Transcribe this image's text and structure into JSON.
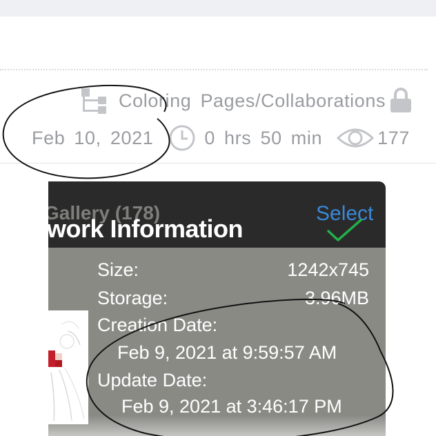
{
  "header": {
    "category": "Coloring Pages/Collaborations",
    "date": "Feb 10, 2021",
    "duration": "0 hrs 50 min",
    "views": "177"
  },
  "dialog": {
    "gallery_title": "Gallery (178)",
    "title": "work Information",
    "select_label": "Select",
    "fields": [
      {
        "label": "Size:",
        "value": "1242x745"
      },
      {
        "label": "Storage:",
        "value": "3.96MB"
      },
      {
        "label": "Creation Date:",
        "value": "Feb 9, 2021 at 9:59:57 AM"
      },
      {
        "label": "Update Date:",
        "value": "Feb 9, 2021 at 3:46:17 PM"
      }
    ]
  },
  "colors": {
    "meta_text": "#9a9ca1",
    "panel_bg": "#8a8a85",
    "header_bg": "#2a2a2a",
    "select_blue": "#3a88d8",
    "check_green": "#22b04a"
  },
  "icons": [
    "folder-tree-icon",
    "lock-icon",
    "clock-icon",
    "eye-icon",
    "checkmark-icon"
  ]
}
